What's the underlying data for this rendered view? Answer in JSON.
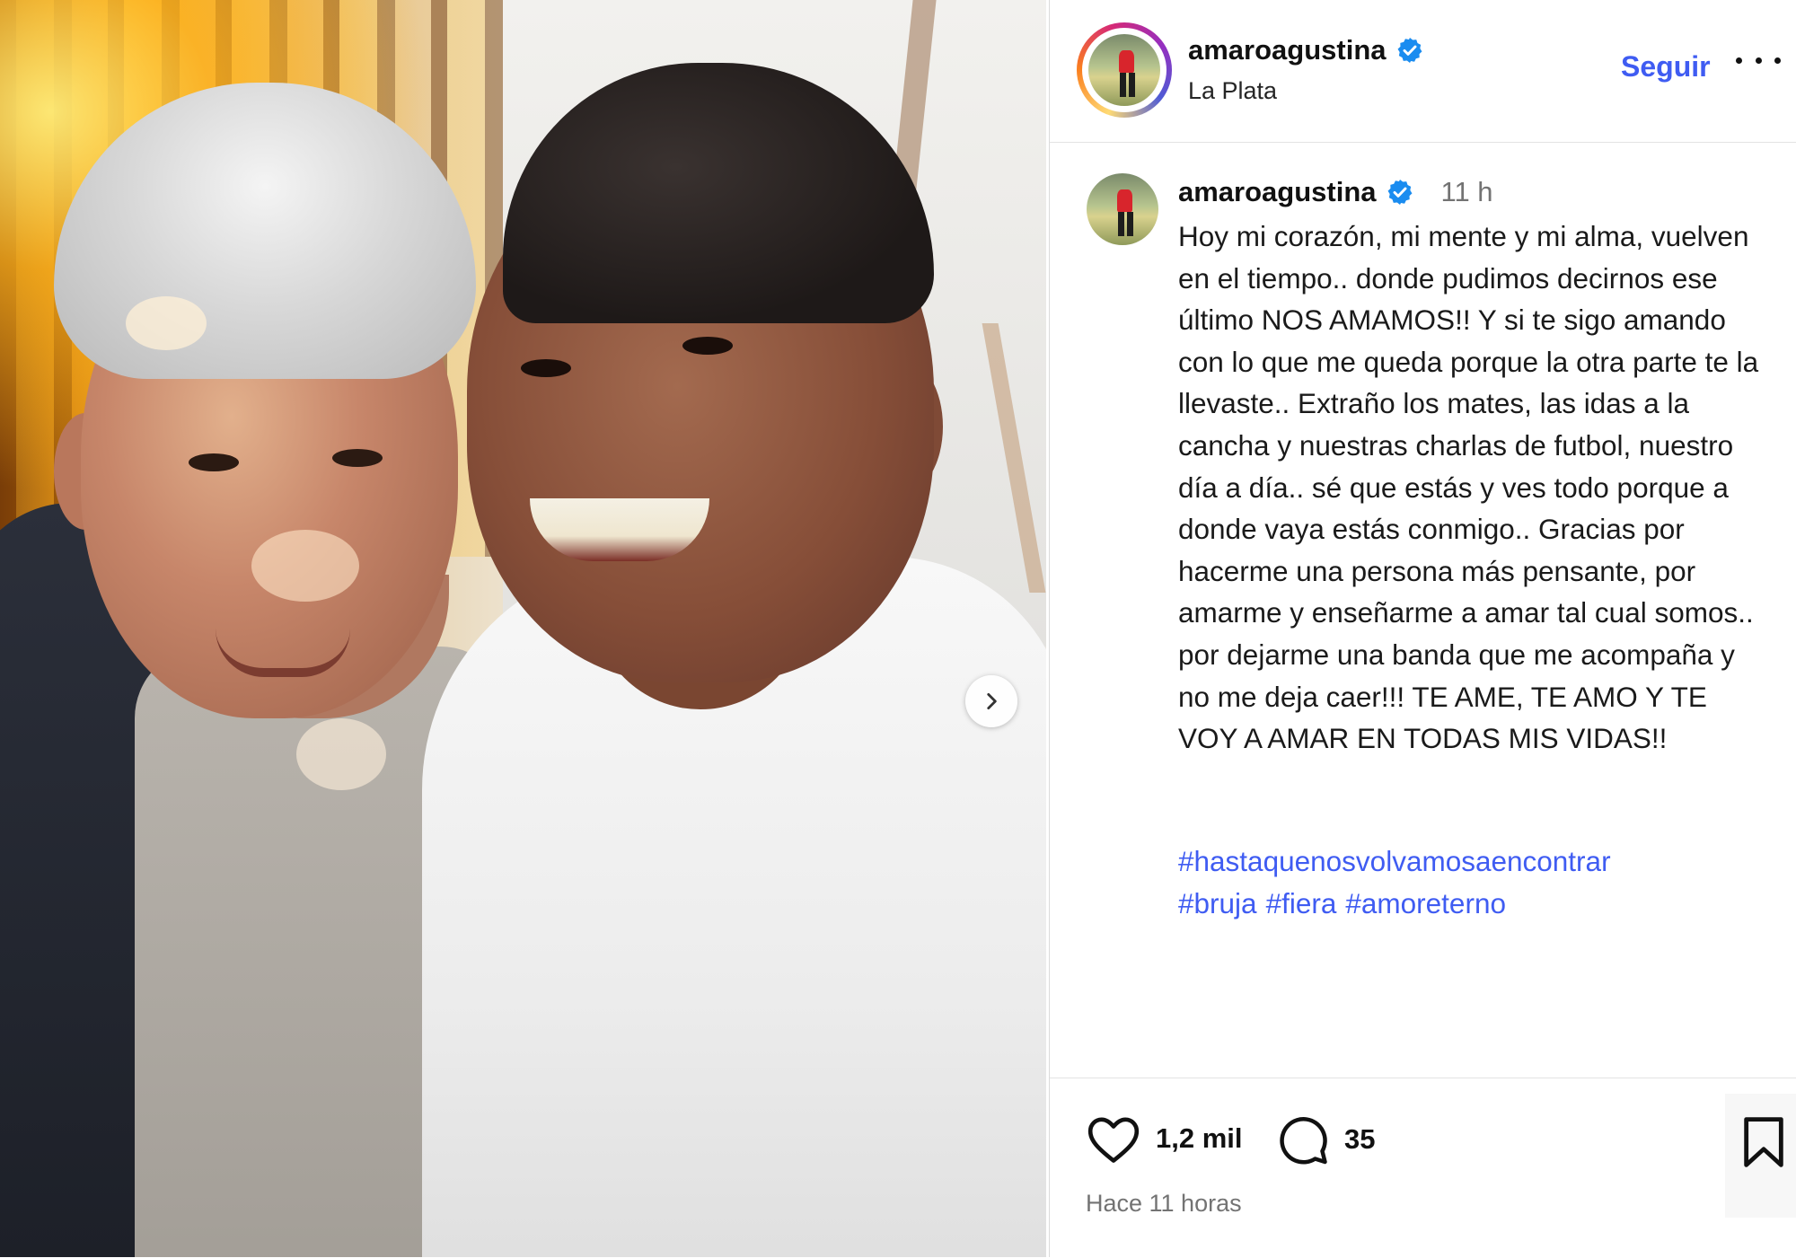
{
  "post": {
    "author": {
      "username": "amaroagustina",
      "location": "La Plata",
      "verified": true
    },
    "header": {
      "follow_label": "Seguir",
      "more_icon": "more-options-icon"
    },
    "caption": {
      "username": "amaroagustina",
      "time_ago": "11 h",
      "text": "Hoy mi corazón, mi mente y mi alma, vuelven en el tiempo.. donde pudimos decirnos ese último NOS AMAMOS!! Y si te sigo amando con lo que me queda porque la otra parte te la llevaste.. Extraño los mates, las idas a la cancha y nuestras charlas de futbol, nuestro día a día.. sé que estás y ves todo porque a donde vaya estás conmigo.. Gracias por hacerme una persona más pensante, por amarme y enseñarme a amar tal cual somos.. por dejarme una banda que me acompaña y no me deja caer!!! TE AME, TE AMO Y TE VOY A AMAR EN TODAS MIS VIDAS!!",
      "hashtags": [
        "#hastaquenosvolvamosaencontrar",
        "#bruja",
        "#fiera",
        "#amoreterno"
      ]
    },
    "stats": {
      "likes": "1,2 mil",
      "comments": "35"
    },
    "posted_ago": "Hace 11 horas",
    "colors": {
      "link_blue": "#3f5cf2",
      "verified_blue": "#1a8cf0",
      "muted_gray": "#737373"
    }
  }
}
